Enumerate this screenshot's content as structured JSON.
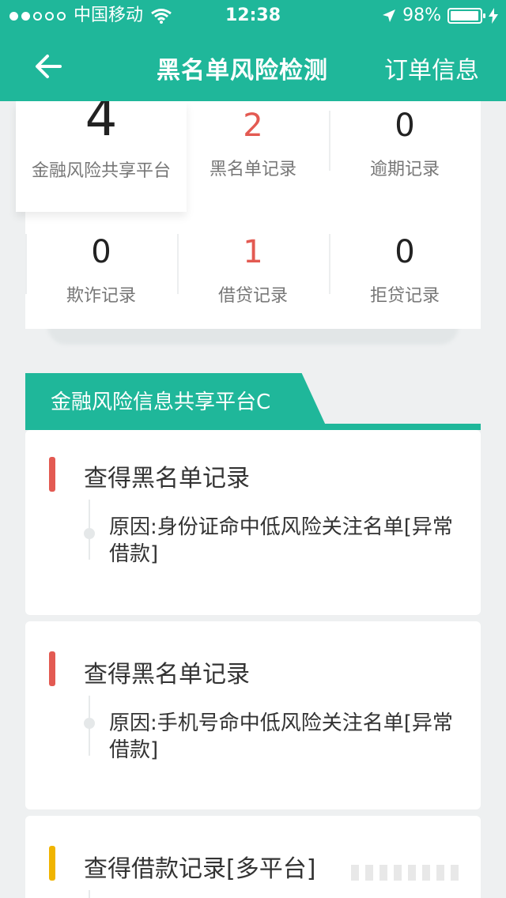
{
  "status_bar": {
    "carrier": "中国移动",
    "time": "12:38",
    "battery_percent": "98%",
    "battery_level": 0.98
  },
  "nav": {
    "title": "黑名单风险检测",
    "action": "订单信息"
  },
  "stats": [
    {
      "value": "4",
      "label": "金融风险共享平台"
    },
    {
      "value": "2",
      "label": "黑名单记录"
    },
    {
      "value": "0",
      "label": "逾期记录"
    },
    {
      "value": "0",
      "label": "欺诈记录"
    },
    {
      "value": "1",
      "label": "借贷记录"
    },
    {
      "value": "0",
      "label": "拒贷记录"
    }
  ],
  "section": {
    "title": "金融风险信息共享平台C"
  },
  "records": [
    {
      "title": "查得黑名单记录",
      "reason": "原因:身份证命中低风险关注名单[异常借款]",
      "color": "#e35a52"
    },
    {
      "title": "查得黑名单记录",
      "reason": "原因:手机号命中低风险关注名单[异常借款]",
      "color": "#e35a52"
    },
    {
      "title": "查得借款记录[多平台]",
      "color": "#f0b400"
    }
  ],
  "colors": {
    "brand": "#1fb79a",
    "alert": "#e35a52",
    "warn": "#f0b400"
  }
}
